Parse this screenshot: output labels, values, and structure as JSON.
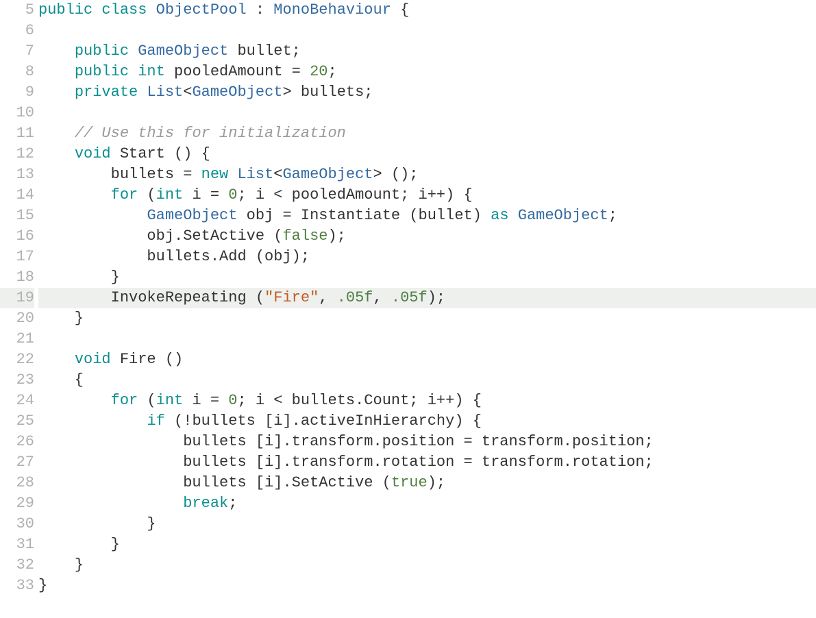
{
  "colors": {
    "keyword": "#0b8f8f",
    "type": "#346aa0",
    "number": "#508040",
    "string": "#c55b20",
    "comment": "#9a9a9a",
    "plain": "#333333"
  },
  "highlightedLine": 19,
  "lines": [
    {
      "n": 5,
      "tokens": [
        {
          "c": "kw",
          "t": "public"
        },
        {
          "c": "plain",
          "t": " "
        },
        {
          "c": "kw",
          "t": "class"
        },
        {
          "c": "plain",
          "t": " "
        },
        {
          "c": "type",
          "t": "ObjectPool"
        },
        {
          "c": "plain",
          "t": " : "
        },
        {
          "c": "type",
          "t": "MonoBehaviour"
        },
        {
          "c": "plain",
          "t": " {"
        }
      ]
    },
    {
      "n": 6,
      "tokens": []
    },
    {
      "n": 7,
      "tokens": [
        {
          "c": "plain",
          "t": "    "
        },
        {
          "c": "kw",
          "t": "public"
        },
        {
          "c": "plain",
          "t": " "
        },
        {
          "c": "type",
          "t": "GameObject"
        },
        {
          "c": "plain",
          "t": " bullet;"
        }
      ]
    },
    {
      "n": 8,
      "tokens": [
        {
          "c": "plain",
          "t": "    "
        },
        {
          "c": "kw",
          "t": "public"
        },
        {
          "c": "plain",
          "t": " "
        },
        {
          "c": "kw",
          "t": "int"
        },
        {
          "c": "plain",
          "t": " pooledAmount = "
        },
        {
          "c": "num",
          "t": "20"
        },
        {
          "c": "plain",
          "t": ";"
        }
      ]
    },
    {
      "n": 9,
      "tokens": [
        {
          "c": "plain",
          "t": "    "
        },
        {
          "c": "kw",
          "t": "private"
        },
        {
          "c": "plain",
          "t": " "
        },
        {
          "c": "type",
          "t": "List"
        },
        {
          "c": "plain",
          "t": "<"
        },
        {
          "c": "type",
          "t": "GameObject"
        },
        {
          "c": "plain",
          "t": "> bullets;"
        }
      ]
    },
    {
      "n": 10,
      "tokens": []
    },
    {
      "n": 11,
      "tokens": [
        {
          "c": "plain",
          "t": "    "
        },
        {
          "c": "cmt",
          "t": "// Use this for initialization"
        }
      ]
    },
    {
      "n": 12,
      "tokens": [
        {
          "c": "plain",
          "t": "    "
        },
        {
          "c": "kw",
          "t": "void"
        },
        {
          "c": "plain",
          "t": " Start () {"
        }
      ]
    },
    {
      "n": 13,
      "tokens": [
        {
          "c": "plain",
          "t": "        bullets = "
        },
        {
          "c": "kw",
          "t": "new"
        },
        {
          "c": "plain",
          "t": " "
        },
        {
          "c": "type",
          "t": "List"
        },
        {
          "c": "plain",
          "t": "<"
        },
        {
          "c": "type",
          "t": "GameObject"
        },
        {
          "c": "plain",
          "t": "> ();"
        }
      ]
    },
    {
      "n": 14,
      "tokens": [
        {
          "c": "plain",
          "t": "        "
        },
        {
          "c": "kw",
          "t": "for"
        },
        {
          "c": "plain",
          "t": " ("
        },
        {
          "c": "kw",
          "t": "int"
        },
        {
          "c": "plain",
          "t": " i = "
        },
        {
          "c": "num",
          "t": "0"
        },
        {
          "c": "plain",
          "t": "; i < pooledAmount; i++) {"
        }
      ]
    },
    {
      "n": 15,
      "tokens": [
        {
          "c": "plain",
          "t": "            "
        },
        {
          "c": "type",
          "t": "GameObject"
        },
        {
          "c": "plain",
          "t": " obj = Instantiate (bullet) "
        },
        {
          "c": "kw",
          "t": "as"
        },
        {
          "c": "plain",
          "t": " "
        },
        {
          "c": "type",
          "t": "GameObject"
        },
        {
          "c": "plain",
          "t": ";"
        }
      ]
    },
    {
      "n": 16,
      "tokens": [
        {
          "c": "plain",
          "t": "            obj.SetActive ("
        },
        {
          "c": "bool",
          "t": "false"
        },
        {
          "c": "plain",
          "t": ");"
        }
      ]
    },
    {
      "n": 17,
      "tokens": [
        {
          "c": "plain",
          "t": "            bullets.Add (obj);"
        }
      ]
    },
    {
      "n": 18,
      "tokens": [
        {
          "c": "plain",
          "t": "        }"
        }
      ]
    },
    {
      "n": 19,
      "tokens": [
        {
          "c": "plain",
          "t": "        InvokeRepeating ("
        },
        {
          "c": "str",
          "t": "\"Fire\""
        },
        {
          "c": "plain",
          "t": ", "
        },
        {
          "c": "num",
          "t": ".05f"
        },
        {
          "c": "plain",
          "t": ", "
        },
        {
          "c": "num",
          "t": ".05f"
        },
        {
          "c": "plain",
          "t": ");"
        }
      ]
    },
    {
      "n": 20,
      "tokens": [
        {
          "c": "plain",
          "t": "    }"
        }
      ]
    },
    {
      "n": 21,
      "tokens": []
    },
    {
      "n": 22,
      "tokens": [
        {
          "c": "plain",
          "t": "    "
        },
        {
          "c": "kw",
          "t": "void"
        },
        {
          "c": "plain",
          "t": " Fire ()"
        }
      ]
    },
    {
      "n": 23,
      "tokens": [
        {
          "c": "plain",
          "t": "    {"
        }
      ]
    },
    {
      "n": 24,
      "tokens": [
        {
          "c": "plain",
          "t": "        "
        },
        {
          "c": "kw",
          "t": "for"
        },
        {
          "c": "plain",
          "t": " ("
        },
        {
          "c": "kw",
          "t": "int"
        },
        {
          "c": "plain",
          "t": " i = "
        },
        {
          "c": "num",
          "t": "0"
        },
        {
          "c": "plain",
          "t": "; i < bullets.Count; i++) {"
        }
      ]
    },
    {
      "n": 25,
      "tokens": [
        {
          "c": "plain",
          "t": "            "
        },
        {
          "c": "kw",
          "t": "if"
        },
        {
          "c": "plain",
          "t": " (!bullets [i].activeInHierarchy) {"
        }
      ]
    },
    {
      "n": 26,
      "tokens": [
        {
          "c": "plain",
          "t": "                bullets [i].transform.position = transform.position;"
        }
      ]
    },
    {
      "n": 27,
      "tokens": [
        {
          "c": "plain",
          "t": "                bullets [i].transform.rotation = transform.rotation;"
        }
      ]
    },
    {
      "n": 28,
      "tokens": [
        {
          "c": "plain",
          "t": "                bullets [i].SetActive ("
        },
        {
          "c": "bool",
          "t": "true"
        },
        {
          "c": "plain",
          "t": ");"
        }
      ]
    },
    {
      "n": 29,
      "tokens": [
        {
          "c": "plain",
          "t": "                "
        },
        {
          "c": "kw",
          "t": "break"
        },
        {
          "c": "plain",
          "t": ";"
        }
      ]
    },
    {
      "n": 30,
      "tokens": [
        {
          "c": "plain",
          "t": "            }"
        }
      ]
    },
    {
      "n": 31,
      "tokens": [
        {
          "c": "plain",
          "t": "        }"
        }
      ]
    },
    {
      "n": 32,
      "tokens": [
        {
          "c": "plain",
          "t": "    }"
        }
      ]
    },
    {
      "n": 33,
      "tokens": [
        {
          "c": "plain",
          "t": "}"
        }
      ]
    }
  ]
}
